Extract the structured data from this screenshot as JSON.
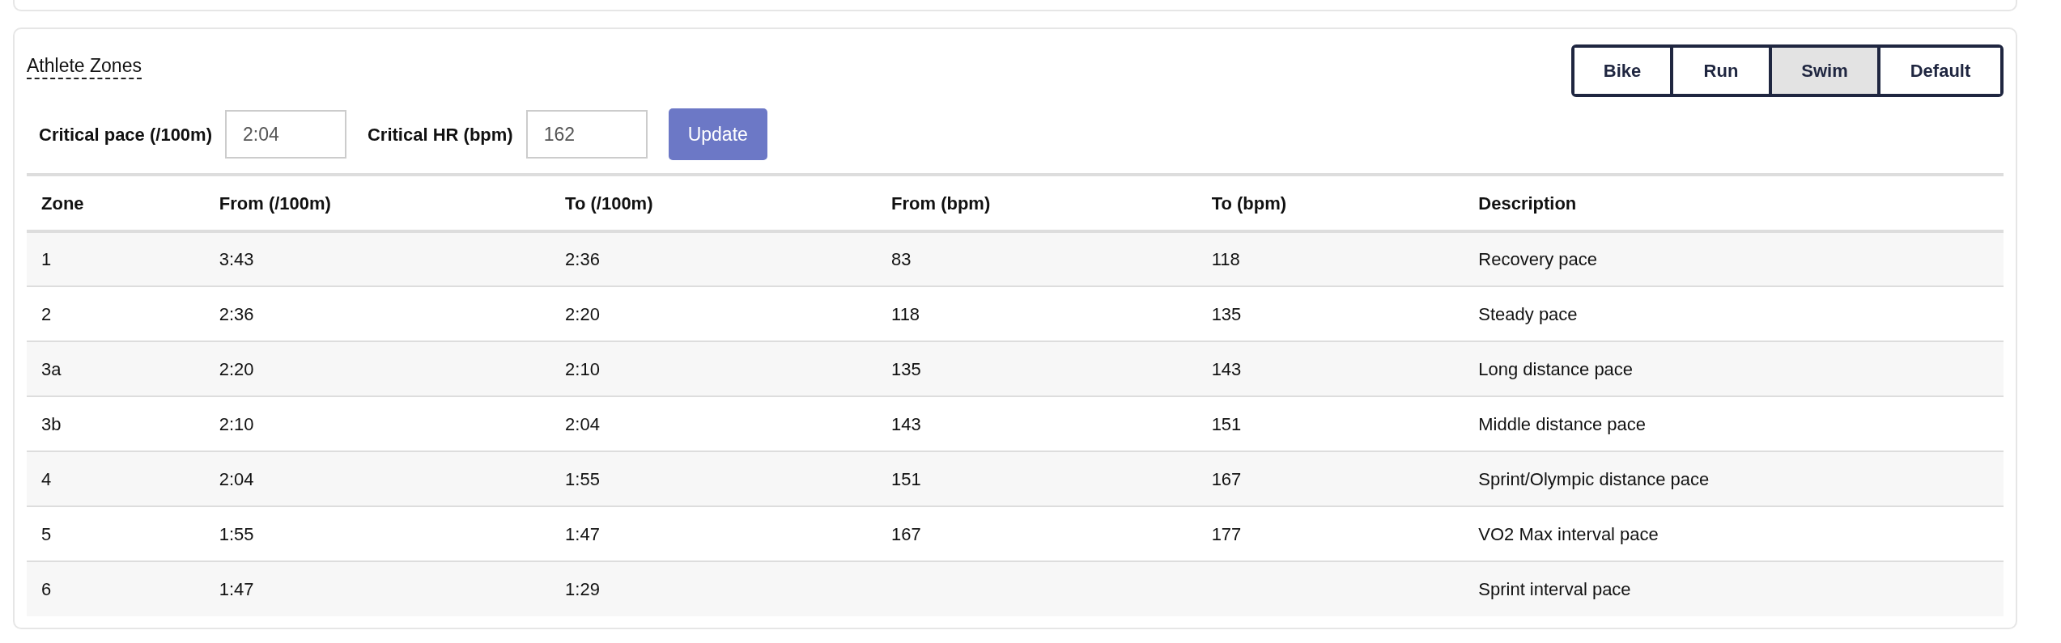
{
  "title": "Athlete Zones",
  "sports": [
    {
      "label": "Bike",
      "selected": false
    },
    {
      "label": "Run",
      "selected": false
    },
    {
      "label": "Swim",
      "selected": true
    },
    {
      "label": "Default",
      "selected": false
    }
  ],
  "fields": [
    {
      "label": "Critical pace (/100m)",
      "value": "2:04"
    },
    {
      "label": "Critical HR (bpm)",
      "value": "162"
    }
  ],
  "update_button": {
    "label": "Update",
    "disabled": true
  },
  "table": {
    "columns": [
      "Zone",
      "From (/100m)",
      "To (/100m)",
      "From (bpm)",
      "To (bpm)",
      "Description"
    ],
    "rows": [
      [
        "1",
        "3:43",
        "2:36",
        "83",
        "118",
        "Recovery pace"
      ],
      [
        "2",
        "2:36",
        "2:20",
        "118",
        "135",
        "Steady pace"
      ],
      [
        "3a",
        "2:20",
        "2:10",
        "135",
        "143",
        "Long distance pace"
      ],
      [
        "3b",
        "2:10",
        "2:04",
        "143",
        "151",
        "Middle distance pace"
      ],
      [
        "4",
        "2:04",
        "1:55",
        "151",
        "167",
        "Sprint/Olympic distance pace"
      ],
      [
        "5",
        "1:55",
        "1:47",
        "167",
        "177",
        "VO2 Max interval pace"
      ],
      [
        "6",
        "1:47",
        "1:29",
        "",
        "",
        "Sprint interval pace"
      ]
    ]
  }
}
